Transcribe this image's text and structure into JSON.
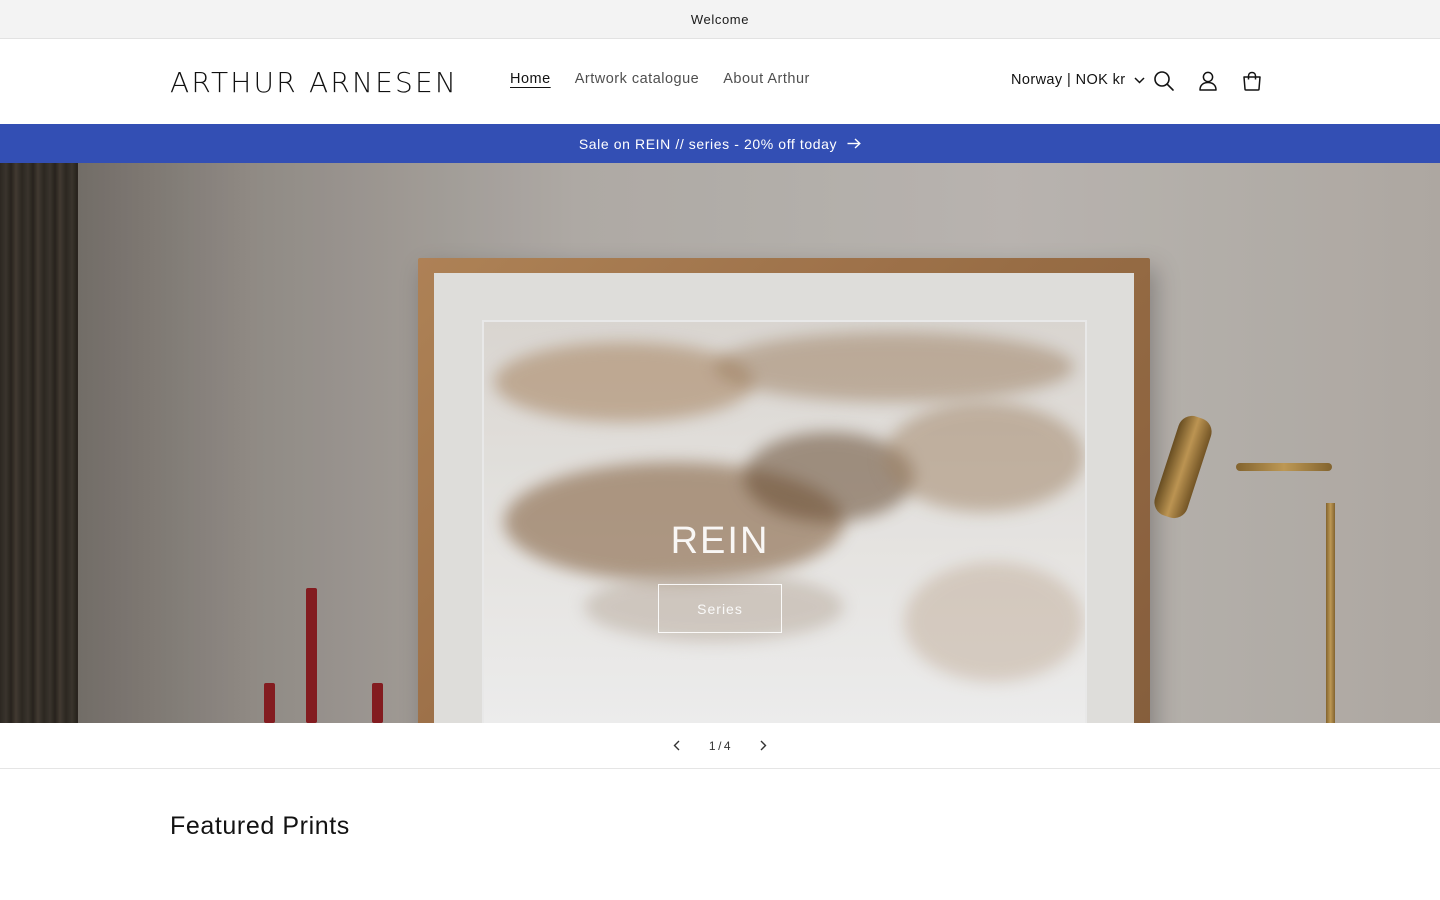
{
  "announcement": {
    "text": "Welcome"
  },
  "header": {
    "logo": "ARTHUR ARNESEN",
    "nav": [
      {
        "label": "Home",
        "active": true
      },
      {
        "label": "Artwork catalogue",
        "active": false
      },
      {
        "label": "About Arthur",
        "active": false
      }
    ],
    "localization": "Norway | NOK kr",
    "icons": [
      "search-icon",
      "account-icon",
      "cart-icon"
    ]
  },
  "sale_bar": {
    "text": "Sale on REIN // series - 20% off today",
    "icon": "arrow-right-icon",
    "color": "#334fb4"
  },
  "hero": {
    "title": "REIN",
    "button_label": "Series"
  },
  "slider": {
    "current": "1",
    "separator": "/",
    "total": "4",
    "prev_icon": "chevron-left-icon",
    "next_icon": "chevron-right-icon"
  },
  "featured": {
    "heading": "Featured Prints"
  }
}
